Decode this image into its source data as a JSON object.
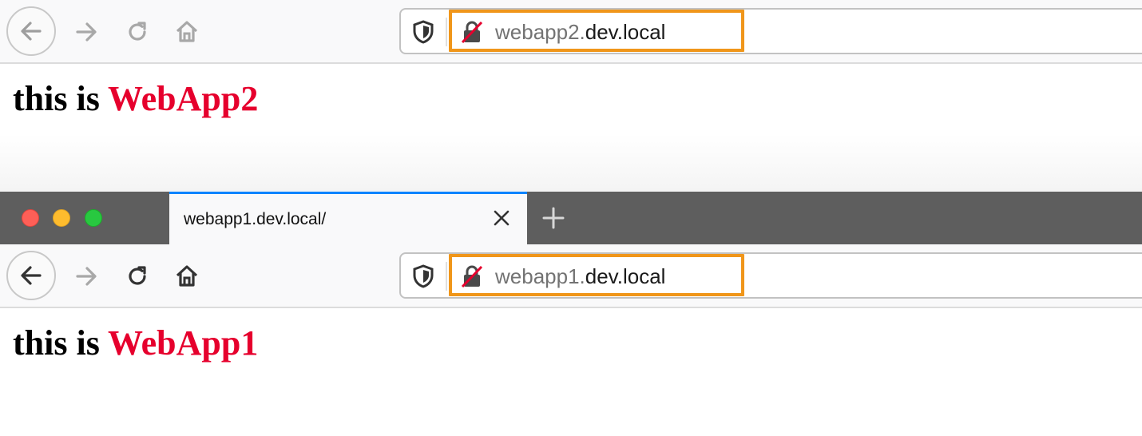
{
  "top_window": {
    "url": {
      "subdomain": "webapp2.",
      "domain": "dev.local"
    },
    "heading": {
      "prefix": "this is ",
      "accent": "WebApp2"
    }
  },
  "bottom_window": {
    "tab": {
      "title": "webapp1.dev.local/"
    },
    "url": {
      "subdomain": "webapp1.",
      "domain": "dev.local"
    },
    "heading": {
      "prefix": "this is ",
      "accent": "WebApp1"
    }
  },
  "colors": {
    "highlight": "#f0961a",
    "accent_text": "#e6002d",
    "active_tab": "#0a84ff"
  },
  "icons": [
    "back-icon",
    "forward-icon",
    "reload-icon",
    "home-icon",
    "shield-icon",
    "broken-lock-icon",
    "close-icon",
    "plus-icon"
  ]
}
